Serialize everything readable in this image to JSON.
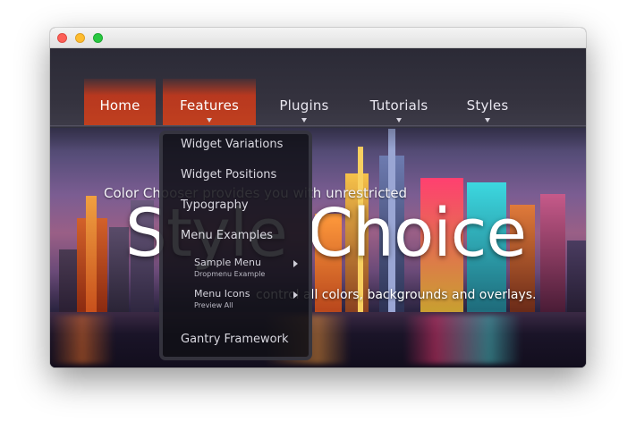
{
  "menu": {
    "items": [
      {
        "label": "Home",
        "active": true
      },
      {
        "label": "Features",
        "active": true,
        "has_dropdown": true
      },
      {
        "label": "Plugins",
        "has_dropdown": true
      },
      {
        "label": "Tutorials",
        "has_dropdown": true
      },
      {
        "label": "Styles",
        "has_dropdown": true
      }
    ],
    "active_color": "#c0401f"
  },
  "hero": {
    "subline": "Color Chooser provides you with unrestricted",
    "title": "Style Choice",
    "tagline": "control all colors, backgrounds and overlays."
  },
  "dropdown": {
    "items": [
      {
        "label": "Widget Variations"
      },
      {
        "label": "Widget Positions"
      },
      {
        "label": "Typography"
      },
      {
        "label": "Menu Examples"
      }
    ],
    "subitems": [
      {
        "label": "Sample Menu",
        "note": "Dropmenu Example"
      },
      {
        "label": "Menu Icons",
        "note": "Preview All"
      }
    ],
    "footer_item": "Gantry Framework"
  }
}
